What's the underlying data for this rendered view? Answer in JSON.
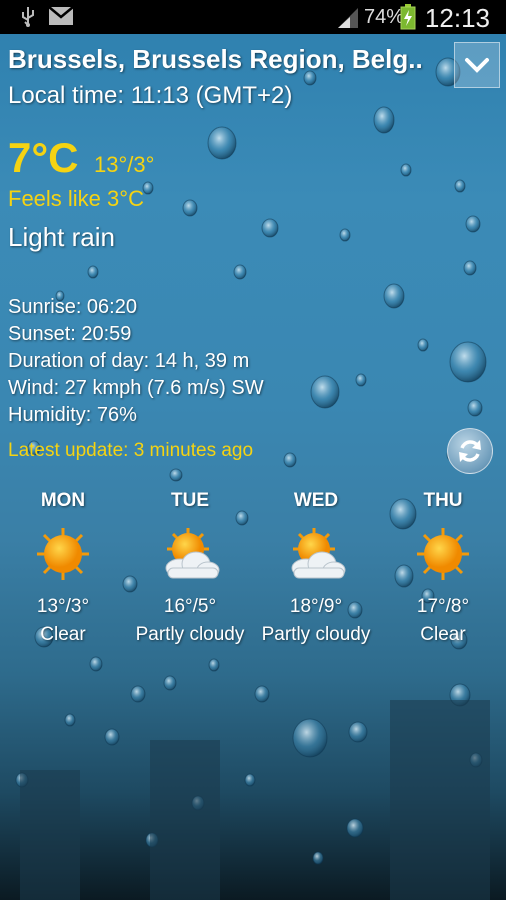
{
  "status_bar": {
    "usb_icon": "usb-icon",
    "mail_icon": "gmail-icon",
    "signal_icon": "signal-icon",
    "battery_percent": "74%",
    "battery_icon": "battery-charging-icon",
    "time": "12:13"
  },
  "header": {
    "location": "Brussels, Brussels Region, Belg..",
    "local_time": "Local time: 11:13 (GMT+2)",
    "dropdown_icon": "chevron-down-icon"
  },
  "current": {
    "temperature": "7°C",
    "hi_lo": "13°/3°",
    "feels_like": "Feels like 3°C",
    "condition": "Light rain"
  },
  "details": {
    "sunrise": "Sunrise: 06:20",
    "sunset": "Sunset: 20:59",
    "duration": "Duration of day: 14 h, 39 m",
    "wind": "Wind: 27 kmph (7.6 m/s) SW",
    "humidity": "Humidity: 76%"
  },
  "update": {
    "latest": "Latest update: 3 minutes ago",
    "refresh_icon": "refresh-icon"
  },
  "forecast": [
    {
      "day": "MON",
      "temps": "13°/3°",
      "condition": "Clear",
      "icon": "sun-icon"
    },
    {
      "day": "TUE",
      "temps": "16°/5°",
      "condition": "Partly cloudy",
      "icon": "partly-cloudy-icon"
    },
    {
      "day": "WED",
      "temps": "18°/9°",
      "condition": "Partly cloudy",
      "icon": "partly-cloudy-icon"
    },
    {
      "day": "THU",
      "temps": "17°/8°",
      "condition": "Clear",
      "icon": "sun-icon"
    }
  ],
  "colors": {
    "accent_yellow": "#f5d312",
    "sky_blue": "#3a87b2"
  }
}
